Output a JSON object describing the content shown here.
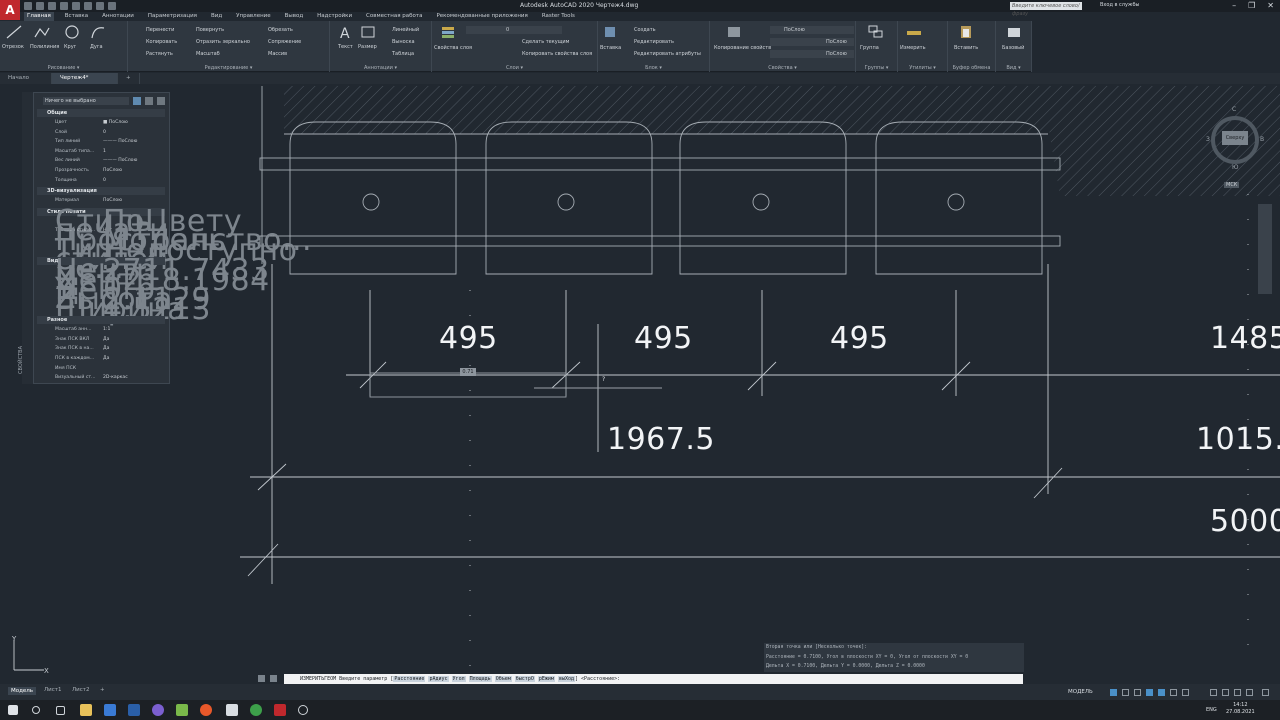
{
  "titlebar": {
    "app_logo": "A",
    "title": "Autodesk AutoCAD 2020   Чертеж4.dwg",
    "search_placeholder": "Введите ключевое слово/фразу",
    "signin": "Вход в службы",
    "controls": [
      "–",
      "❐",
      "✕"
    ]
  },
  "ribbon_tabs": [
    {
      "label": "Главная",
      "active": true
    },
    {
      "label": "Вставка"
    },
    {
      "label": "Аннотации"
    },
    {
      "label": "Параметризация"
    },
    {
      "label": "Вид"
    },
    {
      "label": "Управление"
    },
    {
      "label": "Вывод"
    },
    {
      "label": "Надстройки"
    },
    {
      "label": "Совместная работа"
    },
    {
      "label": "Рекомендованные приложения"
    },
    {
      "label": "Raster Tools"
    }
  ],
  "ribbon": {
    "draw": {
      "items": [
        "Отрезок",
        "Полилиния",
        "Круг",
        "Дуга"
      ],
      "label": "Рисование ▾"
    },
    "modify": {
      "items": [
        "Перенести",
        "Повернуть",
        "Обрезать",
        "Копировать",
        "Отразить зеркально",
        "Сопряжение",
        "Растянуть",
        "Масштаб",
        "Массив"
      ],
      "label": "Редактирование ▾"
    },
    "annotation": {
      "items": [
        "Текст",
        "Размер",
        "Линейный",
        "Выноска",
        "Таблица"
      ],
      "label": "Аннотации ▾"
    },
    "layers": {
      "items": [
        "Свойства слоя",
        "Сделать текущим",
        "Копировать свойства слоя"
      ],
      "layer_value": "0",
      "label": "Слои ▾"
    },
    "block": {
      "items": [
        "Вставка",
        "Создать",
        "Редактировать",
        "Редактировать атрибуты"
      ],
      "label": "Блок ▾"
    },
    "properties": {
      "items": [
        "Копирование свойств",
        "ПоСлою",
        "ПоСлою",
        "ПоСлою"
      ],
      "label": "Свойства ▾"
    },
    "groups": {
      "items": [
        "Группа"
      ],
      "label": "Группы ▾"
    },
    "utilities": {
      "items": [
        "Измерить"
      ],
      "label": "Утилиты ▾"
    },
    "clipboard": {
      "items": [
        "Вставить"
      ],
      "label": "Буфер обмена"
    },
    "view": {
      "items": [
        "Базовый"
      ],
      "label": "Вид ▾"
    }
  },
  "doc_tabs": [
    {
      "label": "Начало"
    },
    {
      "label": "Чертеж4*",
      "active": true
    },
    {
      "label": "+"
    }
  ],
  "properties_palette": {
    "side_title": "СВОЙСТВА",
    "select": "Ничего не выбрано",
    "sections": [
      {
        "title": "Общие",
        "rows": [
          {
            "k": "Цвет",
            "v": "■ ПоСлою"
          },
          {
            "k": "Слой",
            "v": "0"
          },
          {
            "k": "Тип линий",
            "v": "——— ПоСлою"
          },
          {
            "k": "Масштаб типа...",
            "v": "1"
          },
          {
            "k": "Вес линий",
            "v": "——— ПоСлою"
          },
          {
            "k": "Прозрачность",
            "v": "ПоСлою"
          },
          {
            "k": "Толщина",
            "v": "0"
          }
        ]
      },
      {
        "title": "3D-визуализация",
        "rows": [
          {
            "k": "Материал",
            "v": "ПоСлою"
          }
        ]
      },
      {
        "title": "Стиль печати",
        "rows": [
          {
            "k": "Стиль печати",
            "v": "ПоЦвету",
            "dim": true
          },
          {
            "k": "Таблица стиле...",
            "v": "Нет"
          },
          {
            "k": "Пространство...",
            "v": "Модель",
            "dim": true
          },
          {
            "k": "Тип стилей пе...",
            "v": "Недоступно",
            "dim": true
          }
        ]
      },
      {
        "title": "Вид",
        "rows": [
          {
            "k": "Центр X",
            "v": "2711.7433",
            "dim": true
          },
          {
            "k": "Центр Y",
            "v": "1218.1984",
            "dim": true
          },
          {
            "k": "Центр Z",
            "v": "0",
            "dim": true
          },
          {
            "k": "Высота",
            "v": "2.1129",
            "dim": true
          },
          {
            "k": "Ширина",
            "v": "4.5213",
            "dim": true
          }
        ]
      },
      {
        "title": "Разное",
        "rows": [
          {
            "k": "Масштаб анн...",
            "v": "1:1"
          },
          {
            "k": "Знак ПСК ВКЛ",
            "v": "Да"
          },
          {
            "k": "Знак ПСК в на...",
            "v": "Да"
          },
          {
            "k": "ПСК в каждом...",
            "v": "Да"
          },
          {
            "k": "Имя ПСК",
            "v": ""
          },
          {
            "k": "Визуальный ст...",
            "v": "2D-каркас"
          }
        ]
      }
    ]
  },
  "dimensions": {
    "d1": "495",
    "d2": "495",
    "d3": "495",
    "d4": "1485",
    "d5": "1967.5",
    "d6": "1015.",
    "d7": "5000",
    "tooltip": "0.71"
  },
  "viewcube": {
    "top": "Сверху",
    "north": "С",
    "south": "Ю",
    "west": "З",
    "east": "В",
    "wcs": "МСК"
  },
  "command": {
    "history": [
      "Вторая точка или [Несколько точек]:",
      "Расстояние = 0.7100,  Угол в плоскости XY = 0,  Угол от плоскости XY = 0",
      "Дельта X = 0.7100,  Дельта Y = 0.0000,  Дельта Z = 0.0000"
    ],
    "prompt": "ИЗМЕРИТЬГЕОМ Введите параметр",
    "options": [
      "Расстояние",
      "рАдиус",
      "Угол",
      "Площадь",
      "Объем",
      "быстрО",
      "рЕжим",
      "выХод"
    ],
    "default": "<Расстояние>:"
  },
  "layout_tabs": [
    {
      "label": "Модель",
      "active": true
    },
    {
      "label": "Лист1"
    },
    {
      "label": "Лист2"
    },
    {
      "label": "+"
    }
  ],
  "status": {
    "model": "МОДЕЛЬ"
  },
  "taskbar": {
    "lang": "ENG",
    "time": "14:12",
    "date": "27.08.2021"
  },
  "colors": {
    "accent": "#4a90c8",
    "canvas": "#212830",
    "ribbon": "#2f3740",
    "autocad_red": "#c0282d"
  }
}
